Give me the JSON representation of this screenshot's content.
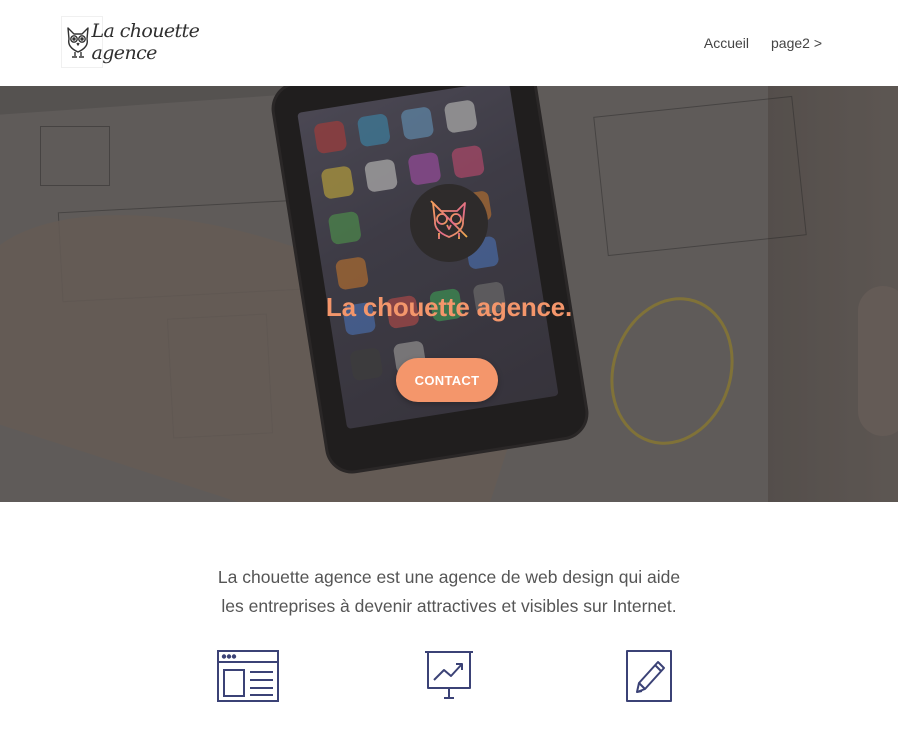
{
  "header": {
    "brand": "La chouette agence",
    "nav": [
      {
        "label": "Accueil"
      },
      {
        "label": "page2 >"
      }
    ]
  },
  "hero": {
    "title": "La chouette agence.",
    "cta_label": "CONTACT",
    "background": "photo-of-phone-and-sketches",
    "badge_icon": "owl-icon"
  },
  "intro": {
    "line1": "La chouette agence est une agence de web design qui aide",
    "line2": "les entreprises à devenir attractives et visibles sur Internet."
  },
  "features": [
    {
      "icon": "web-page-layout-icon"
    },
    {
      "icon": "presentation-chart-icon"
    },
    {
      "icon": "pencil-edit-icon"
    }
  ],
  "colors": {
    "accent": "#f4966b",
    "icon_blue": "#3b4276",
    "text": "#555555",
    "brand_text": "#2f2f2f"
  }
}
